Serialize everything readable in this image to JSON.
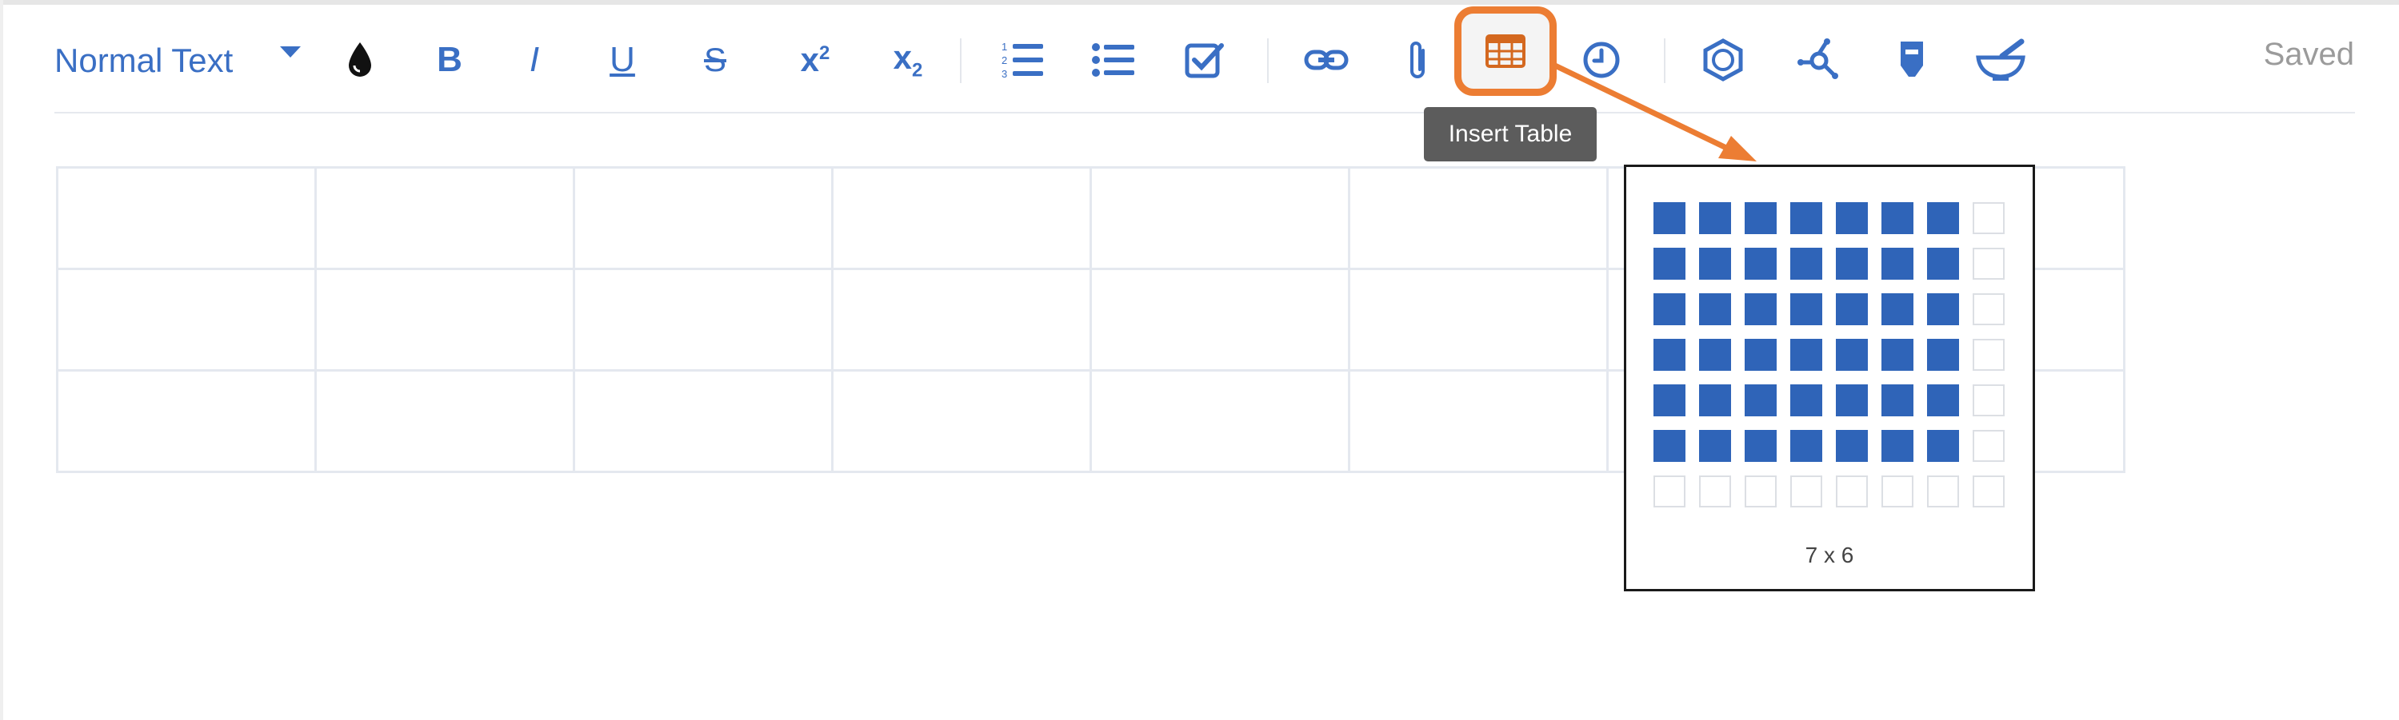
{
  "toolbar": {
    "text_style": "Normal Text",
    "buttons": {
      "text_color": "Text color",
      "bold": "B",
      "italic": "I",
      "underline": "U",
      "strikethrough": "S",
      "superscript_base": "x",
      "superscript_mark": "2",
      "subscript_base": "x",
      "subscript_mark": "2"
    },
    "status": "Saved",
    "accent_color": "#3a6fc4",
    "highlight_color": "#ec7d33"
  },
  "tooltip": {
    "label": "Insert Table"
  },
  "editor_table": {
    "rows": 3,
    "columns": 8
  },
  "table_picker": {
    "grid_columns": 8,
    "grid_rows": 7,
    "selected_columns": 7,
    "selected_rows": 6,
    "size_label": "7 x 6",
    "selected_color": "#2f64b8"
  }
}
